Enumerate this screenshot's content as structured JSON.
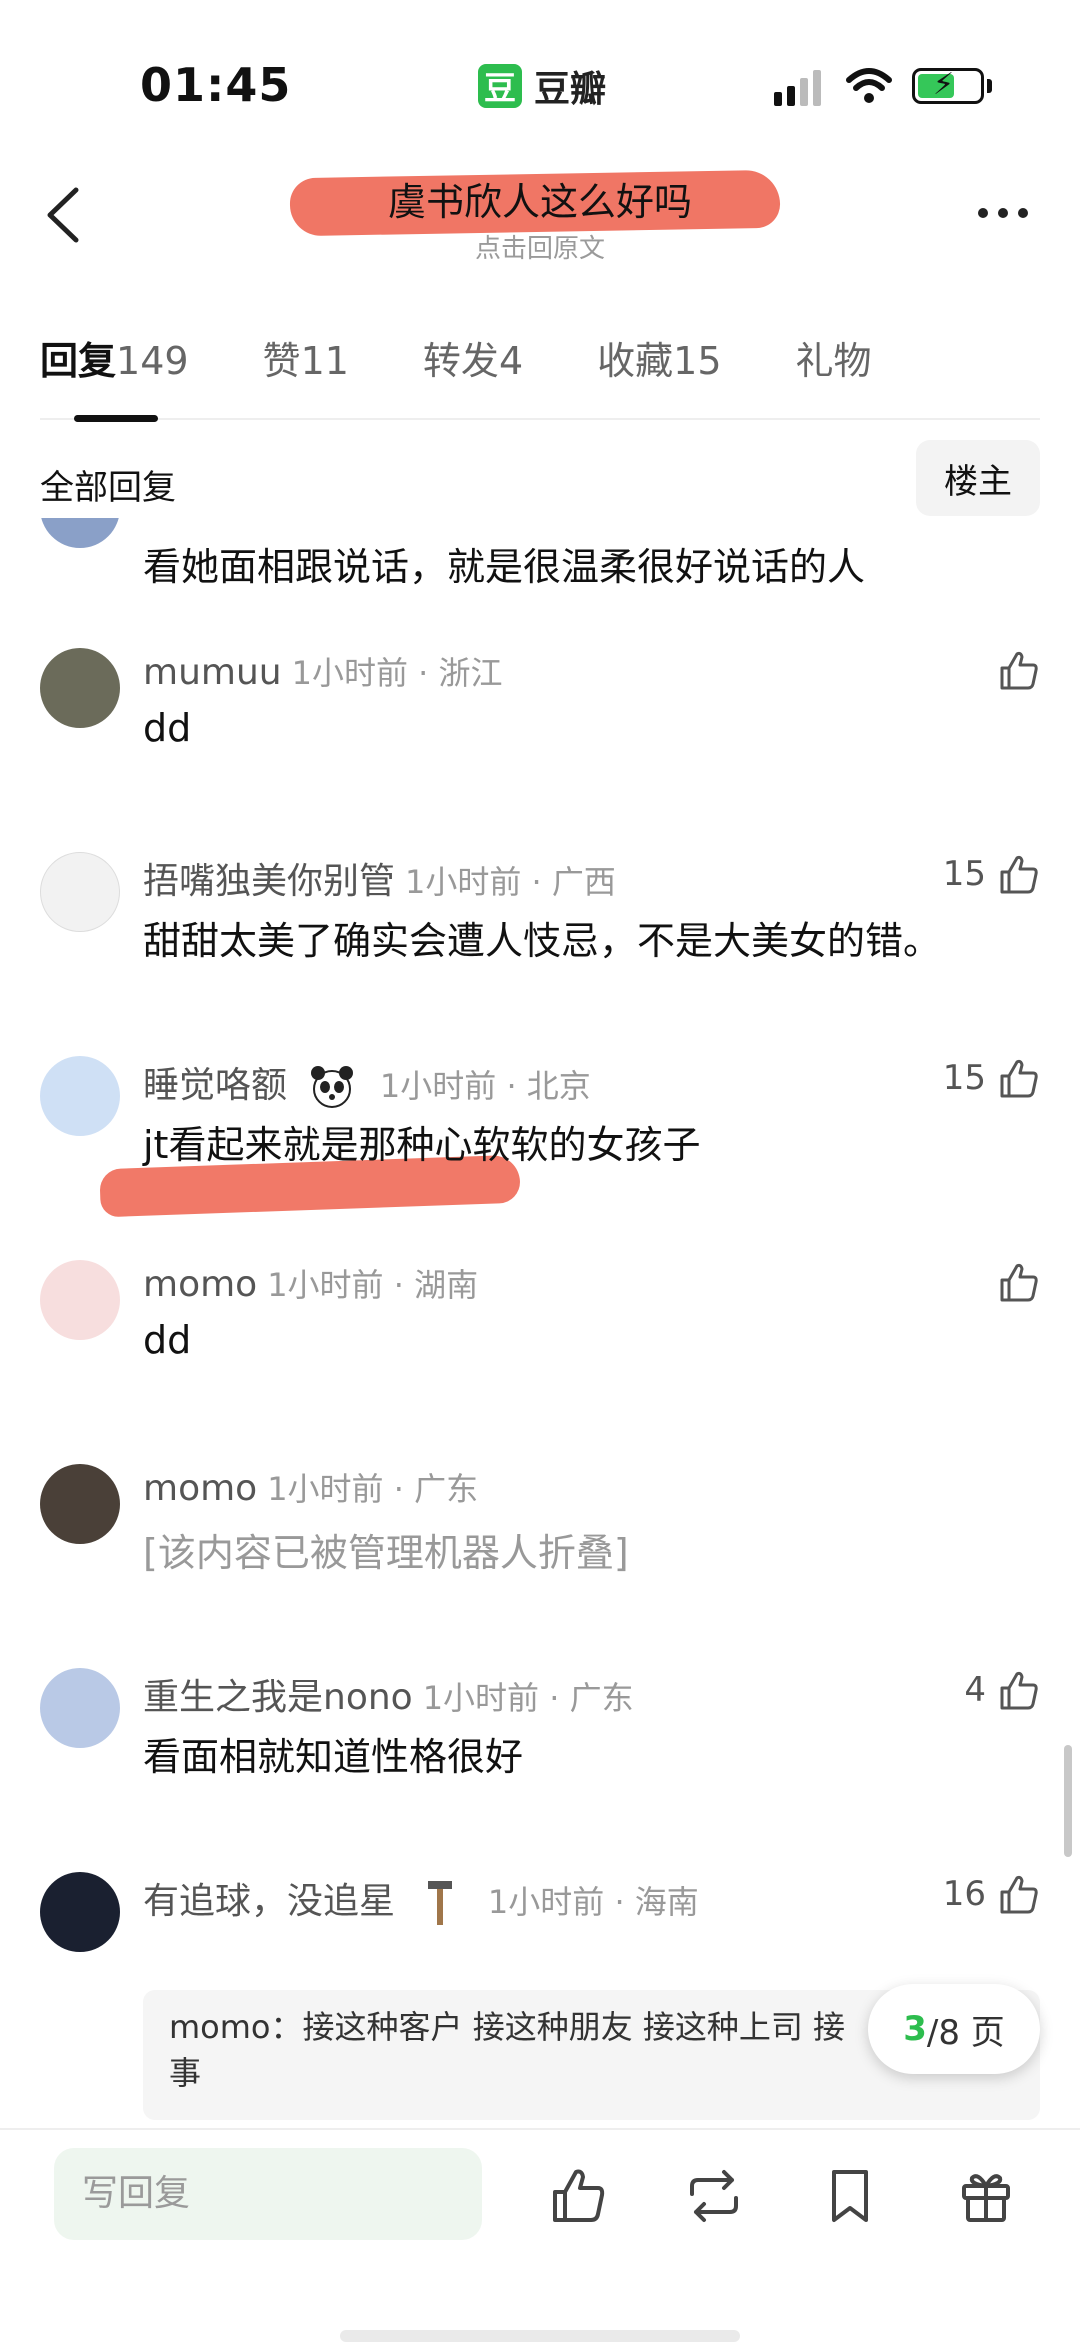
{
  "status_bar": {
    "time": "01:45",
    "app_logo_char": "豆",
    "app_name": "豆瓣",
    "icons": [
      "signal-icon",
      "wifi-icon",
      "battery-charging-icon"
    ]
  },
  "nav": {
    "title": "虞书欣人这么好吗",
    "subtitle": "点击回原文",
    "back_icon": "chevron-left-icon",
    "more_icon": "more-dots-icon",
    "title_highlight_color": "#ef6a58"
  },
  "tabs": [
    {
      "label": "回复",
      "count": "149",
      "active": true
    },
    {
      "label": "赞",
      "count": "11",
      "active": false
    },
    {
      "label": "转发",
      "count": "4",
      "active": false
    },
    {
      "label": "收藏",
      "count": "15",
      "active": false
    },
    {
      "label": "礼物",
      "count": "",
      "active": false
    }
  ],
  "filter": {
    "label": "全部回复",
    "owner_button": "楼主"
  },
  "comments": [
    {
      "name": "",
      "meta": "",
      "content": "看她面相跟说话，就是很温柔很好说话的人",
      "likes": "",
      "avatar_color": "#8aa0c8"
    },
    {
      "name": "mumuu",
      "meta": "1小时前 · 浙江",
      "content": "dd",
      "likes": "",
      "avatar_color": "#6b6b5a"
    },
    {
      "name": "捂嘴独美你别管",
      "meta": "1小时前 · 广西",
      "content": "甜甜太美了确实会遭人忮忌，不是大美女的错。",
      "likes": "15",
      "avatar_color": "#f2f2f2"
    },
    {
      "name": "睡觉咯额",
      "meta": "1小时前 · 北京",
      "content": "jt看起来就是那种心软软的女孩子",
      "likes": "15",
      "avatar_color": "#cfe0f5"
    },
    {
      "name": "momo",
      "meta": "1小时前 · 湖南",
      "content": "dd",
      "likes": "",
      "avatar_color": "#f7dede"
    },
    {
      "name": "momo",
      "meta": "1小时前 · 广东",
      "content": "[该内容已被管理机器人折叠]",
      "likes": "",
      "avatar_color": "#4a4038"
    },
    {
      "name": "重生之我是nono",
      "meta": "1小时前 · 广东",
      "content": "看面相就知道性格很好",
      "likes": "4",
      "avatar_color": "#b9c9e6"
    },
    {
      "name": "有追球，没追星",
      "meta": "1小时前 · 海南",
      "content": "",
      "likes": "16",
      "avatar_color": "#1a2030"
    }
  ],
  "quote": {
    "author": "momo：",
    "text_line1": "接这种客户 接这种朋友 接这种上司 接",
    "text_line2": "事"
  },
  "pagination": {
    "current": "3",
    "total": "/8 页"
  },
  "bottom_bar": {
    "reply_placeholder": "写回复",
    "actions": [
      "like-icon",
      "repost-icon",
      "bookmark-icon",
      "gift-icon"
    ]
  },
  "colors": {
    "brand_green": "#2dbd4e",
    "highlight_red": "#ef6a58",
    "meta_gray": "#999999"
  }
}
